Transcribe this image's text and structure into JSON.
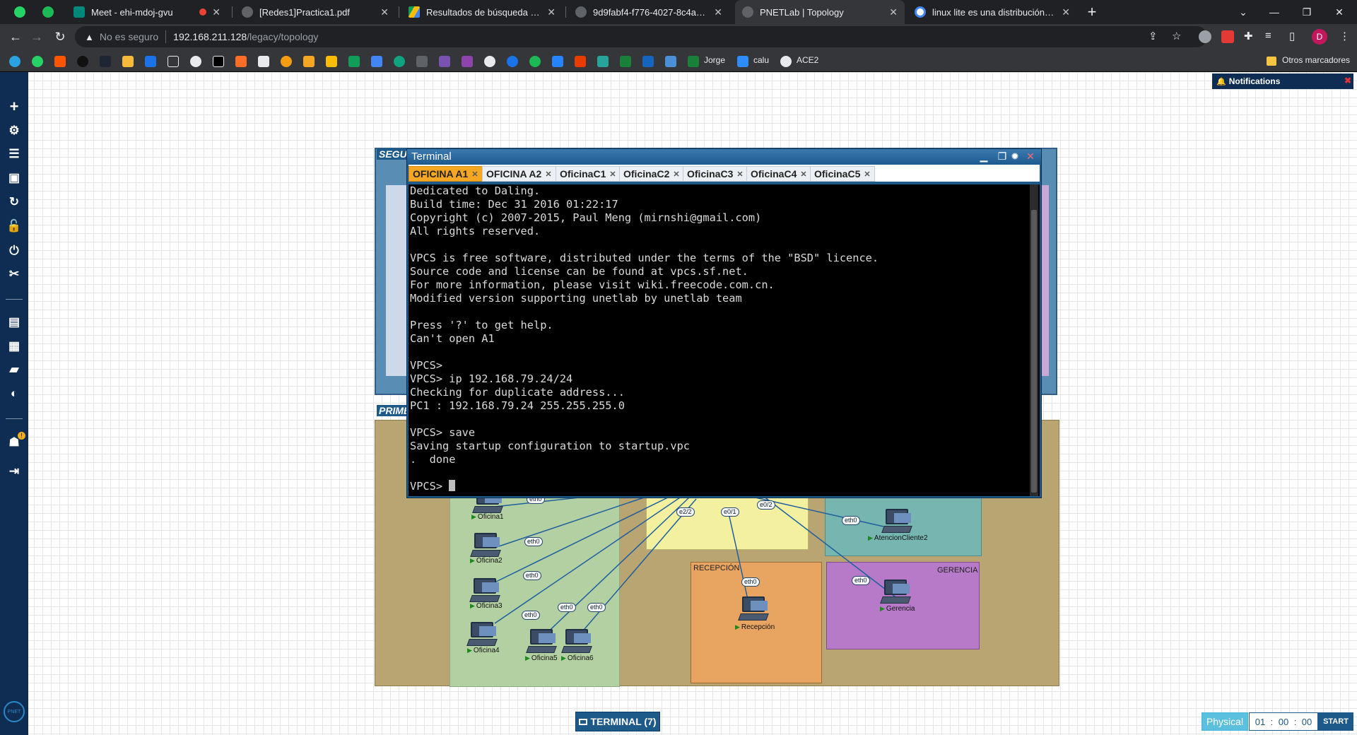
{
  "browser": {
    "tabs": [
      {
        "title": "Meet - ehi-mdoj-gvu",
        "fav_color": "#00897b"
      },
      {
        "title": "[Redes1]Practica1.pdf",
        "fav_color": "#9aa0a6"
      },
      {
        "title": "Resultados de búsqueda - Google Drive",
        "fav_color": "#fbbc04"
      },
      {
        "title": "9d9fabf4-f776-4027-8c4a-c8af7",
        "fav_color": "#9aa0a6"
      },
      {
        "title": "PNETLab | Topology",
        "fav_color": "#9aa0a6"
      },
      {
        "title": "linux lite es una distribución de linux",
        "fav_color": "#4285f4"
      }
    ],
    "address": {
      "security": "No es seguro",
      "host": "192.168.211.128",
      "path": "/legacy/topology"
    },
    "bookmarks": {
      "items": [
        {
          "label": "Jorge"
        },
        {
          "label": "calu"
        },
        {
          "label": "ACE2"
        }
      ],
      "other": "Otros marcadores"
    },
    "profile_initial": "D"
  },
  "notifications": {
    "title": "Notifications"
  },
  "zones": {
    "top_label": "SEGU",
    "bottom_label": "PRIME",
    "recepcion": "RECEPCIÓN",
    "gerencia": "GERENCIA"
  },
  "nodes": {
    "oficina1": "Oficina1",
    "oficina2": "Oficina2",
    "oficina3": "Oficina3",
    "oficina4": "Oficina4",
    "oficina5": "Oficina5",
    "oficina6": "Oficina6",
    "atencion2": "AtencionCliente2",
    "gerencia": "Gerencia",
    "recepcion": "Recepción"
  },
  "interfaces": {
    "eth0": "eth0",
    "e0_1": "e0/1",
    "e0_2": "e0/2",
    "e2_2": "e2/2"
  },
  "terminal": {
    "title": "Terminal",
    "tabs": [
      "OFICINA A1",
      "OFICINA A2",
      "OficinaC1",
      "OficinaC2",
      "OficinaC3",
      "OficinaC4",
      "OficinaC5"
    ],
    "lines": [
      "Dedicated to Daling.",
      "Build time: Dec 31 2016 01:22:17",
      "Copyright (c) 2007-2015, Paul Meng (mirnshi@gmail.com)",
      "All rights reserved.",
      "",
      "VPCS is free software, distributed under the terms of the \"BSD\" licence.",
      "Source code and license can be found at vpcs.sf.net.",
      "For more information, please visit wiki.freecode.com.cn.",
      "Modified version supporting unetlab by unetlab team",
      "",
      "Press '?' to get help.",
      "Can't open A1",
      "",
      "VPCS>",
      "VPCS> ip 192.168.79.24/24",
      "Checking for duplicate address...",
      "PC1 : 192.168.79.24 255.255.255.0",
      "",
      "VPCS> save",
      "Saving startup configuration to startup.vpc",
      ".  done",
      ""
    ],
    "prompt": "VPCS> "
  },
  "footer": {
    "terminal_button": "TERMINAL (7)",
    "physical": "Physical",
    "timer": {
      "h": "01",
      "m": "00",
      "s": "00"
    },
    "start": "START"
  },
  "colors": {
    "sidebar": "#0f2d52",
    "accent": "#1d5a8a",
    "active_tab": "#f5a623",
    "zone_outer": "#b9a572",
    "zone_green": "#b3d0a3",
    "zone_yellow": "#f3f1a0",
    "zone_teal": "#76b5b0",
    "zone_orange": "#e8a562",
    "zone_purple": "#b67ac8"
  }
}
